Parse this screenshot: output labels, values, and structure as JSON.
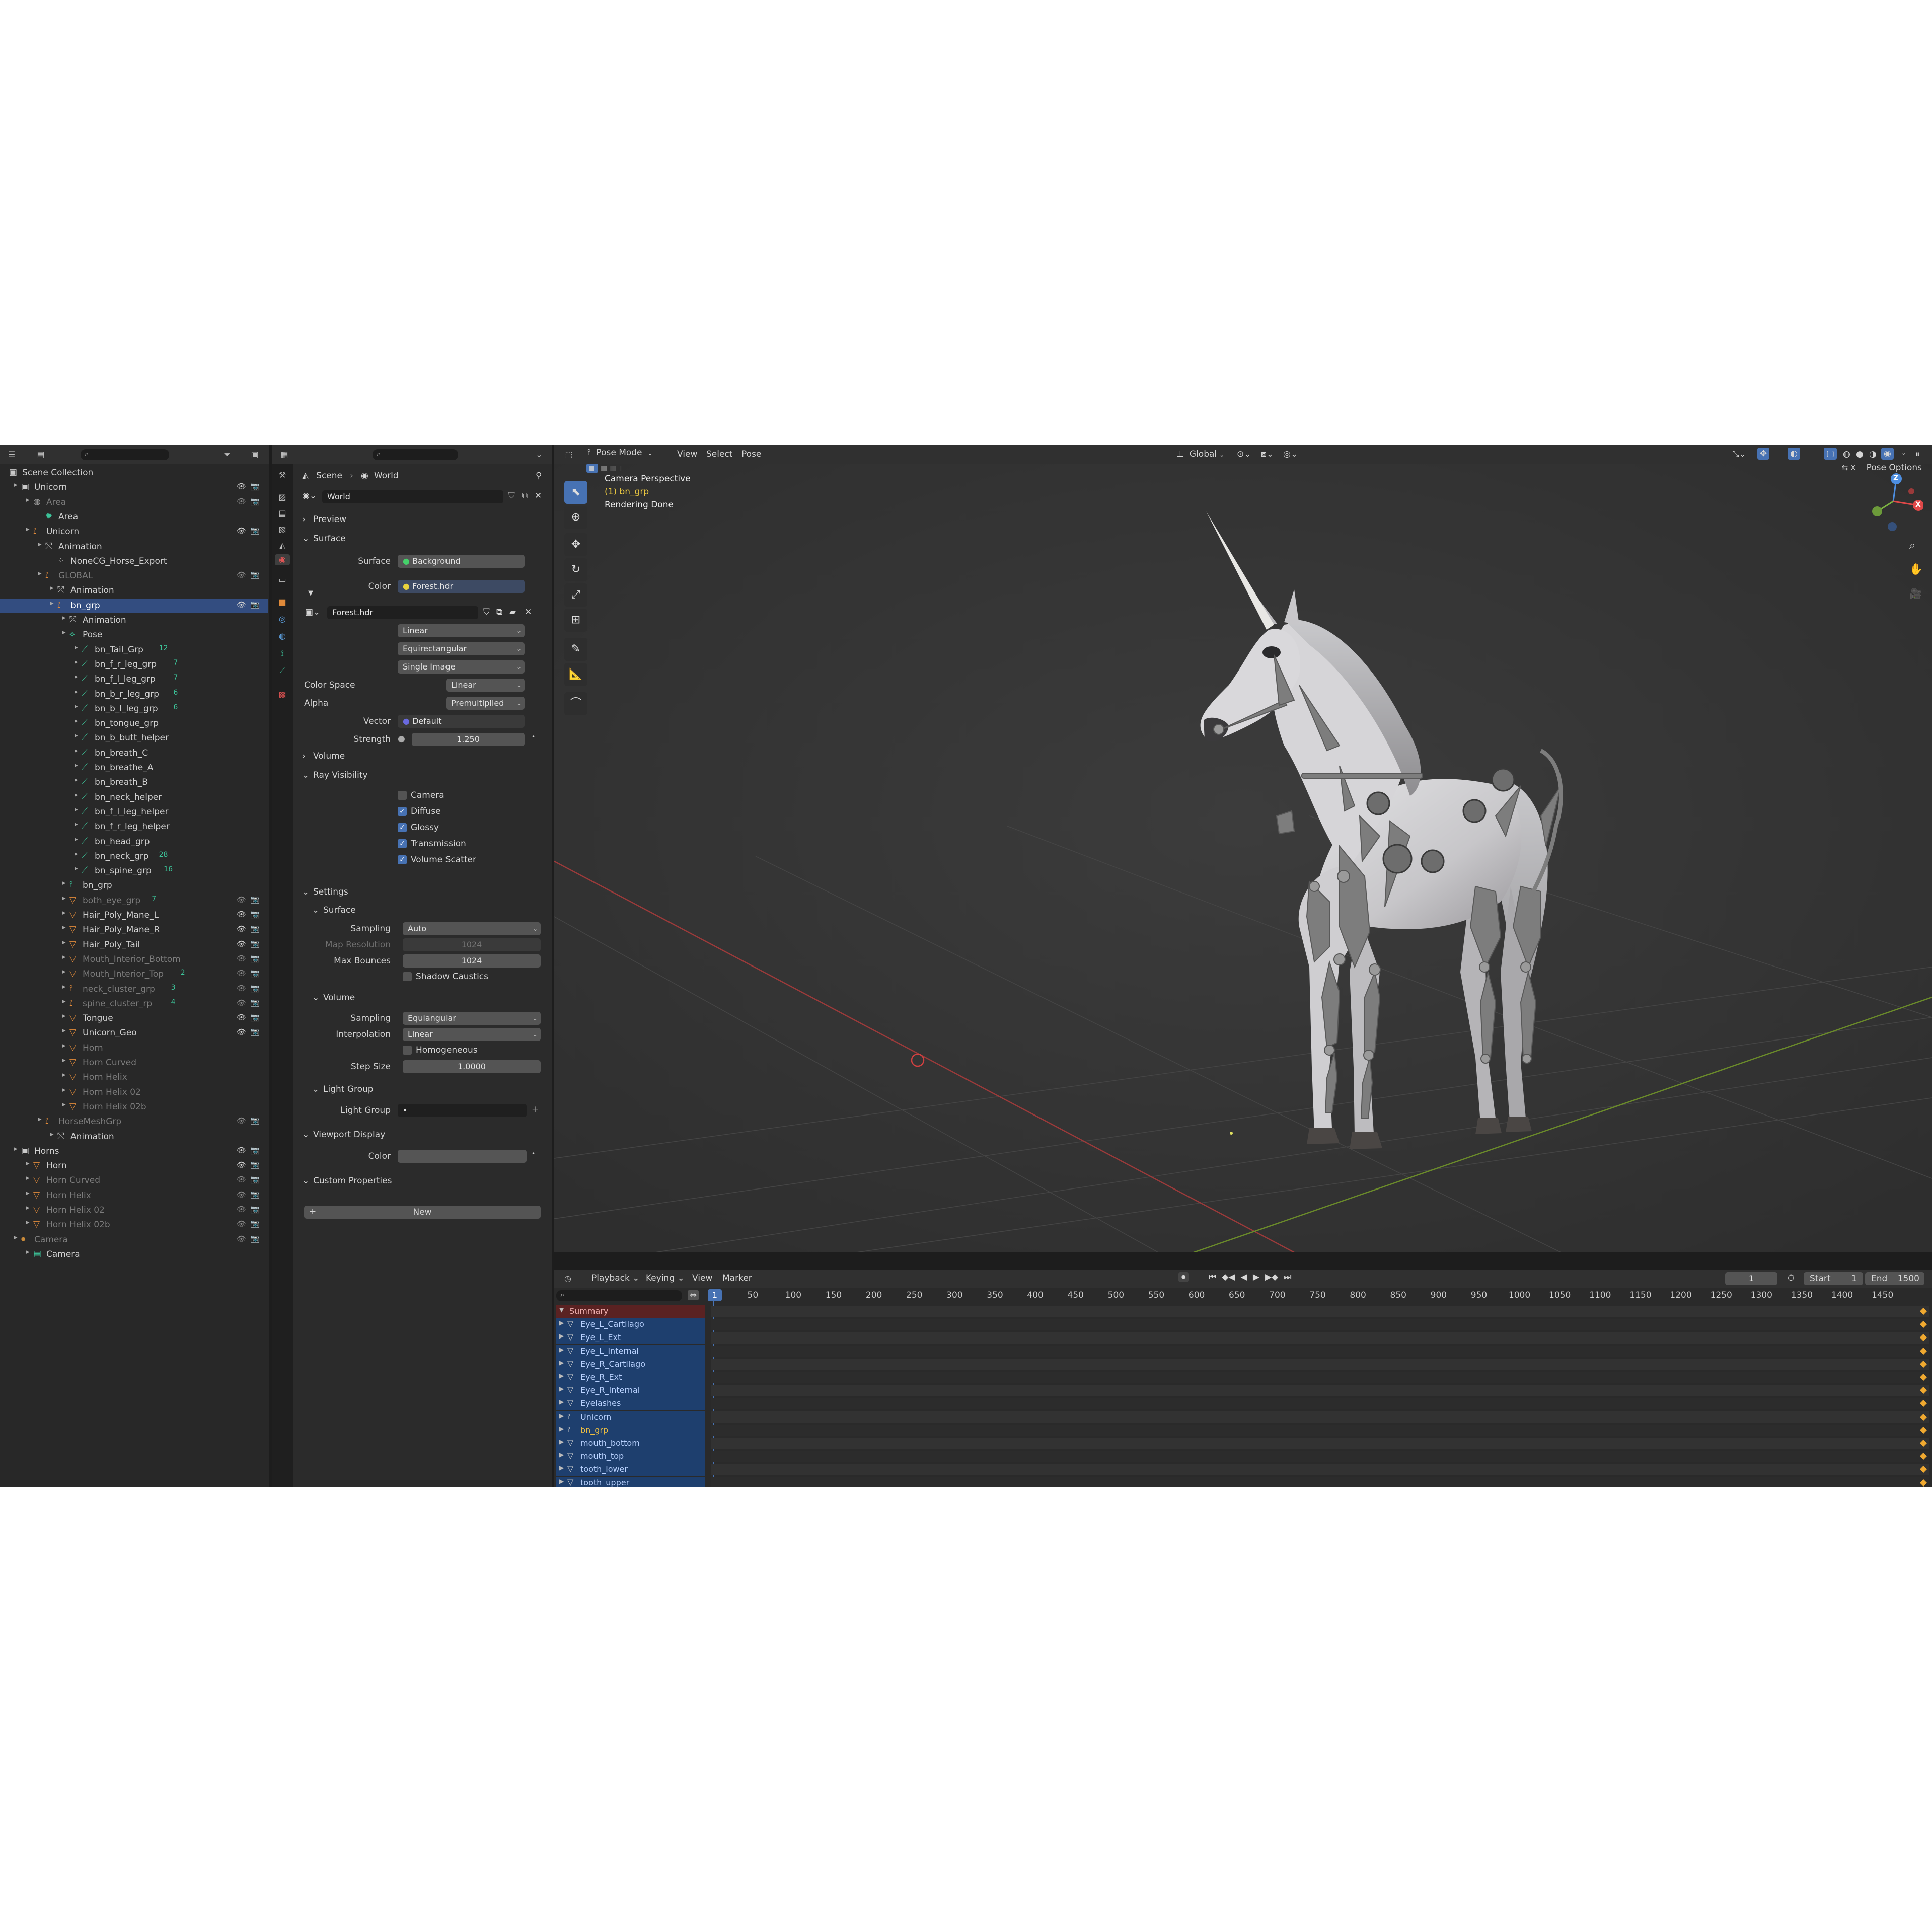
{
  "topbar": {
    "outliner_search_icon": "search-icon",
    "properties_search_icon": "search-icon",
    "mode": "Pose Mode",
    "menu": [
      "View",
      "Select",
      "Pose"
    ],
    "transform_orientation": "Global",
    "pose_options": "Pose Options"
  },
  "outliner": {
    "rows": [
      {
        "label": "Scene Collection",
        "indent": 0,
        "icon": "collection-icon",
        "dim": false
      },
      {
        "label": "Unicorn",
        "indent": 1,
        "icon": "collection-icon",
        "dim": false,
        "eye": true
      },
      {
        "label": "Area",
        "indent": 2,
        "icon": "light-icon",
        "dim": true,
        "eye": true
      },
      {
        "label": "Area",
        "indent": 3,
        "icon": "light-data-icon",
        "dim": false
      },
      {
        "label": "Unicorn",
        "indent": 2,
        "icon": "armature-icon",
        "dim": false,
        "eye": true
      },
      {
        "label": "Animation",
        "indent": 3,
        "icon": "animation-icon",
        "dim": false
      },
      {
        "label": "NoneCG_Horse_Export",
        "indent": 4,
        "icon": "action-icon",
        "dim": false
      },
      {
        "label": "GLOBAL",
        "indent": 3,
        "icon": "armature-icon",
        "dim": true,
        "eye": true
      },
      {
        "label": "Animation",
        "indent": 4,
        "icon": "animation-icon",
        "dim": false
      },
      {
        "label": "bn_grp",
        "indent": 4,
        "icon": "armature-icon",
        "dim": false,
        "eye": true,
        "selected": true
      },
      {
        "label": "Animation",
        "indent": 5,
        "icon": "animation-icon",
        "dim": false
      },
      {
        "label": "Pose",
        "indent": 5,
        "icon": "pose-icon",
        "dim": false
      },
      {
        "label": "bn_Tail_Grp",
        "indent": 6,
        "icon": "bone-icon",
        "dim": false,
        "badge": "12"
      },
      {
        "label": "bn_f_r_leg_grp",
        "indent": 6,
        "icon": "bone-icon",
        "dim": false,
        "badge": "7"
      },
      {
        "label": "bn_f_l_leg_grp",
        "indent": 6,
        "icon": "bone-icon",
        "dim": false,
        "badge": "7"
      },
      {
        "label": "bn_b_r_leg_grp",
        "indent": 6,
        "icon": "bone-icon",
        "dim": false,
        "badge": "6"
      },
      {
        "label": "bn_b_l_leg_grp",
        "indent": 6,
        "icon": "bone-icon",
        "dim": false,
        "badge": "6"
      },
      {
        "label": "bn_tongue_grp",
        "indent": 6,
        "icon": "bone-icon",
        "dim": false
      },
      {
        "label": "bn_b_butt_helper",
        "indent": 6,
        "icon": "bone-icon",
        "dim": false
      },
      {
        "label": "bn_breath_C",
        "indent": 6,
        "icon": "bone-icon",
        "dim": false
      },
      {
        "label": "bn_breathe_A",
        "indent": 6,
        "icon": "bone-icon",
        "dim": false
      },
      {
        "label": "bn_breath_B",
        "indent": 6,
        "icon": "bone-icon",
        "dim": false
      },
      {
        "label": "bn_neck_helper",
        "indent": 6,
        "icon": "bone-icon",
        "dim": false
      },
      {
        "label": "bn_f_l_leg_helper",
        "indent": 6,
        "icon": "bone-icon",
        "dim": false
      },
      {
        "label": "bn_f_r_leg_helper",
        "indent": 6,
        "icon": "bone-icon",
        "dim": false
      },
      {
        "label": "bn_head_grp",
        "indent": 6,
        "icon": "bone-icon",
        "dim": false
      },
      {
        "label": "bn_neck_grp",
        "indent": 6,
        "icon": "bone-icon",
        "dim": false,
        "badge": "28"
      },
      {
        "label": "bn_spine_grp",
        "indent": 6,
        "icon": "bone-icon",
        "dim": false,
        "badge": "16"
      },
      {
        "label": "bn_grp",
        "indent": 5,
        "icon": "armature-data-icon",
        "dim": false
      },
      {
        "label": "both_eye_grp",
        "indent": 5,
        "icon": "mesh-icon",
        "dim": true,
        "eye": true,
        "badge": "7"
      },
      {
        "label": "Hair_Poly_Mane_L",
        "indent": 5,
        "icon": "mesh-icon",
        "dim": false,
        "eye": true
      },
      {
        "label": "Hair_Poly_Mane_R",
        "indent": 5,
        "icon": "mesh-icon",
        "dim": false,
        "eye": true
      },
      {
        "label": "Hair_Poly_Tail",
        "indent": 5,
        "icon": "mesh-icon",
        "dim": false,
        "eye": true
      },
      {
        "label": "Mouth_Interior_Bottom",
        "indent": 5,
        "icon": "mesh-icon",
        "dim": true,
        "eye": true
      },
      {
        "label": "Mouth_Interior_Top",
        "indent": 5,
        "icon": "mesh-icon",
        "dim": true,
        "eye": true,
        "badge": "2"
      },
      {
        "label": "neck_cluster_grp",
        "indent": 5,
        "icon": "armature-icon",
        "dim": true,
        "eye": true,
        "badge": "3"
      },
      {
        "label": "spine_cluster_rp",
        "indent": 5,
        "icon": "armature-icon",
        "dim": true,
        "eye": true,
        "badge": "4"
      },
      {
        "label": "Tongue",
        "indent": 5,
        "icon": "mesh-icon",
        "dim": false,
        "eye": true
      },
      {
        "label": "Unicorn_Geo",
        "indent": 5,
        "icon": "mesh-icon",
        "dim": false,
        "eye": true
      },
      {
        "label": "Horn",
        "indent": 5,
        "icon": "mesh-icon",
        "dim": true
      },
      {
        "label": "Horn Curved",
        "indent": 5,
        "icon": "mesh-icon",
        "dim": true
      },
      {
        "label": "Horn Helix",
        "indent": 5,
        "icon": "mesh-icon",
        "dim": true
      },
      {
        "label": "Horn Helix 02",
        "indent": 5,
        "icon": "mesh-icon",
        "dim": true
      },
      {
        "label": "Horn Helix 02b",
        "indent": 5,
        "icon": "mesh-icon",
        "dim": true
      },
      {
        "label": "HorseMeshGrp",
        "indent": 3,
        "icon": "armature-icon",
        "dim": true,
        "eye": true
      },
      {
        "label": "Animation",
        "indent": 4,
        "icon": "animation-icon",
        "dim": false
      },
      {
        "label": "Horns",
        "indent": 1,
        "icon": "collection-icon",
        "dim": false,
        "eye": true
      },
      {
        "label": "Horn",
        "indent": 2,
        "icon": "mesh-icon",
        "dim": false,
        "eye": true
      },
      {
        "label": "Horn Curved",
        "indent": 2,
        "icon": "mesh-icon",
        "dim": true,
        "eye": true
      },
      {
        "label": "Horn Helix",
        "indent": 2,
        "icon": "mesh-icon",
        "dim": true,
        "eye": true
      },
      {
        "label": "Horn Helix 02",
        "indent": 2,
        "icon": "mesh-icon",
        "dim": true,
        "eye": true
      },
      {
        "label": "Horn Helix 02b",
        "indent": 2,
        "icon": "mesh-icon",
        "dim": true,
        "eye": true
      },
      {
        "label": "Camera",
        "indent": 1,
        "icon": "camera-icon",
        "dim": true,
        "eye": true
      },
      {
        "label": "Camera",
        "indent": 2,
        "icon": "camera-data-icon",
        "dim": false
      }
    ]
  },
  "properties": {
    "breadcrumb": [
      "Scene",
      "World"
    ],
    "world_name": "World",
    "sections": {
      "preview": "Preview",
      "surface": "Surface",
      "volume": "Volume",
      "ray_visibility": "Ray Visibility",
      "settings": "Settings",
      "settings_surface": "Surface",
      "settings_volume": "Volume",
      "light_group": "Light Group",
      "viewport_display": "Viewport Display",
      "custom_properties": "Custom Properties"
    },
    "surface_label": "Surface",
    "surface_value": "Background",
    "color_label": "Color",
    "color_value": "Forest.hdr",
    "image_name": "Forest.hdr",
    "interp_value": "Linear",
    "projection_value": "Equirectangular",
    "source_value": "Single Image",
    "color_space_label": "Color Space",
    "color_space_value": "Linear",
    "alpha_label": "Alpha",
    "alpha_value": "Premultiplied",
    "vector_label": "Vector",
    "vector_value": "Default",
    "strength_label": "Strength",
    "strength_value": "1.250",
    "ray": [
      {
        "label": "Camera",
        "checked": false
      },
      {
        "label": "Diffuse",
        "checked": true
      },
      {
        "label": "Glossy",
        "checked": true
      },
      {
        "label": "Transmission",
        "checked": true
      },
      {
        "label": "Volume Scatter",
        "checked": true
      }
    ],
    "sampling_label": "Sampling",
    "sampling_value": "Auto",
    "map_res_label": "Map Resolution",
    "map_res_value": "1024",
    "max_bounces_label": "Max Bounces",
    "max_bounces_value": "1024",
    "shadow_caustics": "Shadow Caustics",
    "vol_sampling_label": "Sampling",
    "vol_sampling_value": "Equiangular",
    "vol_interp_label": "Interpolation",
    "vol_interp_value": "Linear",
    "homogeneous": "Homogeneous",
    "step_size_label": "Step Size",
    "step_size_value": "1.0000",
    "light_group_label": "Light Group",
    "vp_color_label": "Color",
    "new_button": "New"
  },
  "viewport": {
    "overlay_line1": "Camera Perspective",
    "overlay_line2": "(1) bn_grp",
    "overlay_line3": "Rendering Done",
    "gizmo_z": "Z",
    "gizmo_x": "X"
  },
  "timeline": {
    "menu": [
      "Playback",
      "Keying",
      "View",
      "Marker"
    ],
    "current_frame": "1",
    "start_label": "Start",
    "start_value": "1",
    "end_label": "End",
    "end_value": "1500",
    "ruler": [
      "1",
      "50",
      "100",
      "150",
      "200",
      "250",
      "300",
      "350",
      "400",
      "450",
      "500",
      "550",
      "600",
      "650",
      "700",
      "750",
      "800",
      "850",
      "900",
      "950",
      "1000",
      "1050",
      "1100",
      "1150",
      "1200",
      "1250",
      "1300",
      "1350",
      "1400",
      "1450"
    ],
    "channels": [
      "Summary",
      "Eye_L_Cartilago",
      "Eye_L_Ext",
      "Eye_L_Internal",
      "Eye_R_Cartilago",
      "Eye_R_Ext",
      "Eye_R_Internal",
      "Eyelashes",
      "Unicorn",
      "bn_grp",
      "mouth_bottom",
      "mouth_top",
      "tooth_lower",
      "tooth_upper"
    ]
  },
  "colors": {
    "accent": "#4772b3",
    "selected_row": "#334d80",
    "keyframe": "#f0a930",
    "summary": "#5a2222"
  }
}
